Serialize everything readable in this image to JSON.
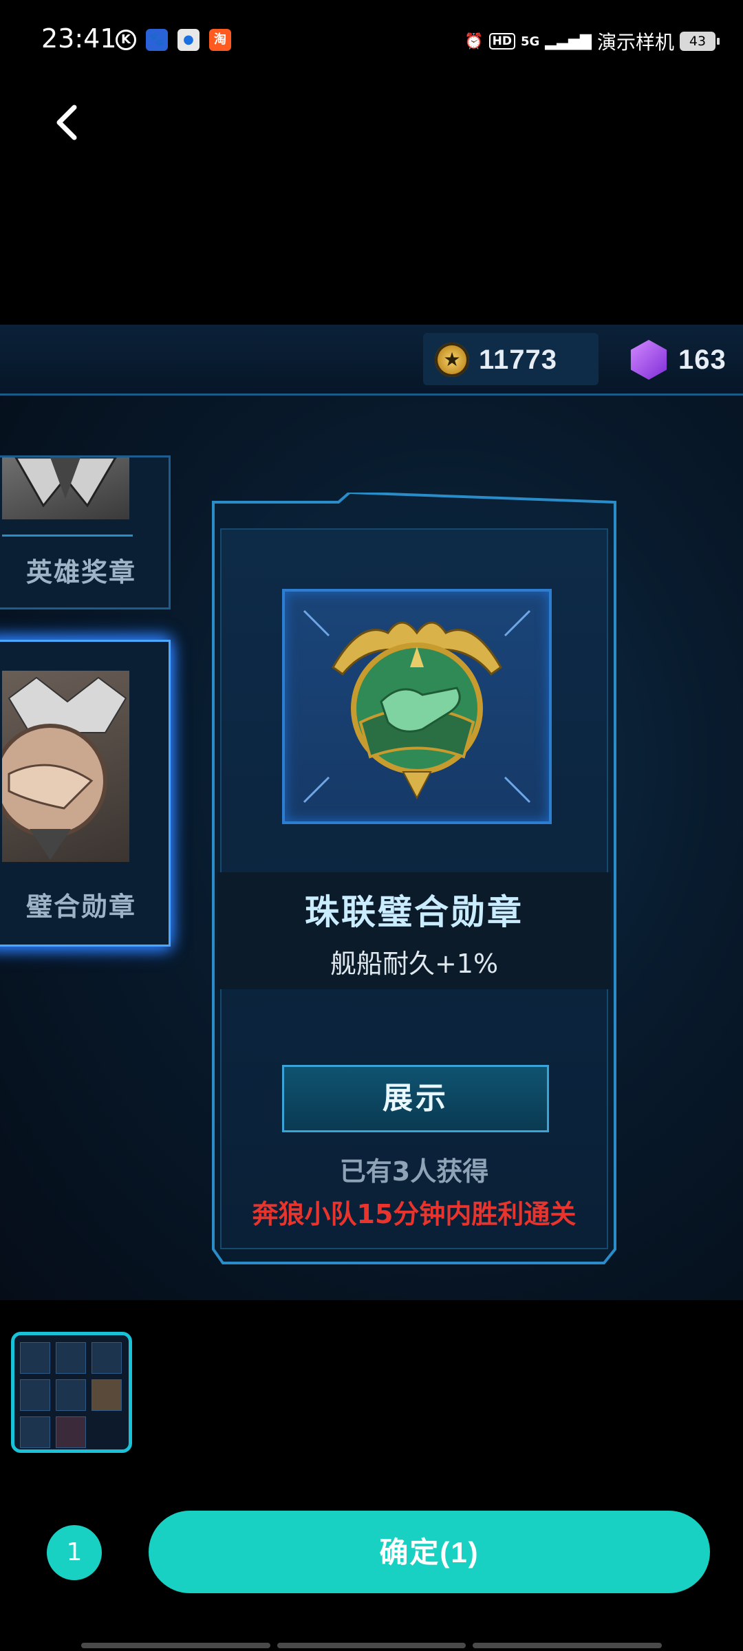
{
  "status_bar": {
    "time": "23:41",
    "carrier": "演示样机",
    "battery": "43",
    "network": "5G",
    "hd": "HD",
    "icons": [
      "k-icon",
      "baidu-app-icon",
      "app-icon",
      "taobao-icon",
      "alarm-icon",
      "signal-icon"
    ]
  },
  "nav": {
    "back_icon": "chevron-left-icon"
  },
  "game": {
    "currencies": {
      "gold": "11773",
      "gems": "163"
    },
    "list": [
      {
        "label": "英雄奖章"
      },
      {
        "label": "璧合勋章"
      }
    ],
    "detail": {
      "name": "珠联璧合勋章",
      "attribute": "舰船耐久+1%",
      "show_button": "展示",
      "owners": "已有3人获得",
      "condition": "奔狼小队15分钟内胜利通关"
    },
    "colors": {
      "condition": "#e8342c",
      "accent": "#2a8cc8"
    }
  },
  "picker": {
    "selected_count": "1",
    "confirm_label": "确定(1)",
    "accent": "#19d1c3"
  }
}
